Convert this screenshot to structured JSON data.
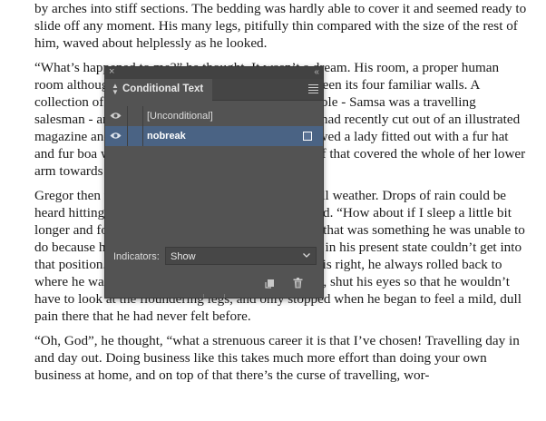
{
  "document": {
    "paragraphs": [
      "by arches into stiff sections. The bedding was hardly able to cover it and seemed ready to slide off any moment. His many legs, pitifully thin compared with the size of the rest of him, waved about helplessly as he looked.",
      "“What’s happened to me?” he thought. It wasn’t a dream. His room, a proper human room although a little too small, lay peacefully between its four familiar walls. A collection of textile samples lay spread out on the table - Samsa was a travelling salesman - and above it there hung a picture that he had recently cut out of an illustrated magazine and housed in a nice, gilded frame. It showed a lady fitted out with a fur hat and fur boa who sat upright, raising a heavy fur muff that covered the whole of her lower arm towards the viewer.",
      "Gregor then turned to look out the window at the dull weather. Drops of rain could be heard hitting the pane, which made him feel quite sad. “How about if I sleep a little bit longer and forget all this nonsense”, he thought, but that was something he was unable to do because he was used to sleeping on his right, and in his present state couldn’t get into that position. However hard he threw himself onto his right, he always rolled back to where he was. He must have tried it a hundred times, shut his eyes so that he wouldn’t have to look at the floundering legs, and only stopped when he began to feel a mild, dull pain there that he had never felt before.",
      "“Oh, God”, he thought, “what a strenuous career it is that I’ve chosen! Travelling day in and day out. Doing business like this takes much more effort than doing your own business at home, and on top of that there’s the curse of travelling, wor-"
    ]
  },
  "panel": {
    "title": "Conditional Text",
    "close_glyph": "×",
    "collapse_glyph": "‹‹",
    "conditions": [
      {
        "label": "[Unconditional]",
        "visible": true,
        "selected": false,
        "has_swatch": false
      },
      {
        "label": "nobreak",
        "visible": true,
        "selected": true,
        "has_swatch": true
      }
    ],
    "indicators_label": "Indicators:",
    "indicators_value": "Show",
    "icons": {
      "eye": "eye-icon",
      "new_condition": "new-condition-icon",
      "delete": "trash-icon",
      "menu": "panel-menu-icon"
    },
    "colors": {
      "panel_bg": "#535353",
      "selection": "#4a6384"
    }
  }
}
